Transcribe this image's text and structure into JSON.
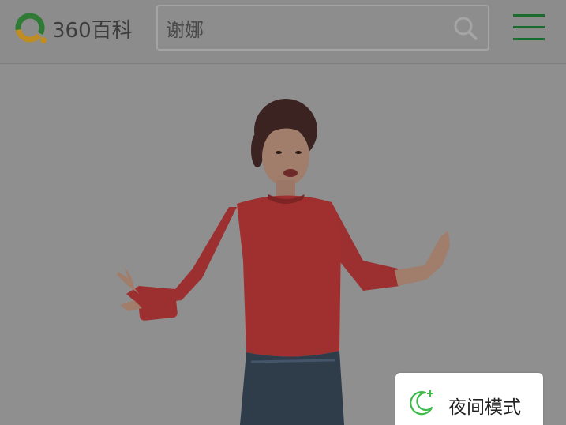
{
  "header": {
    "logo_text": "360百科",
    "search": {
      "value": "谢娜",
      "placeholder": ""
    },
    "search_icon": "search-icon",
    "menu_icon": "hamburger-menu-icon"
  },
  "hero": {
    "image_subject": "woman-in-red-sweater-photo"
  },
  "night_mode": {
    "label": "夜间模式",
    "icon": "moon-icon"
  },
  "colors": {
    "overlay_gray": "#8f8f8f",
    "brand_green": "#1b6a2e",
    "logo_orange": "#e2a32b",
    "logo_green": "#2f8a3c",
    "moon_green": "#3cbb4a"
  }
}
